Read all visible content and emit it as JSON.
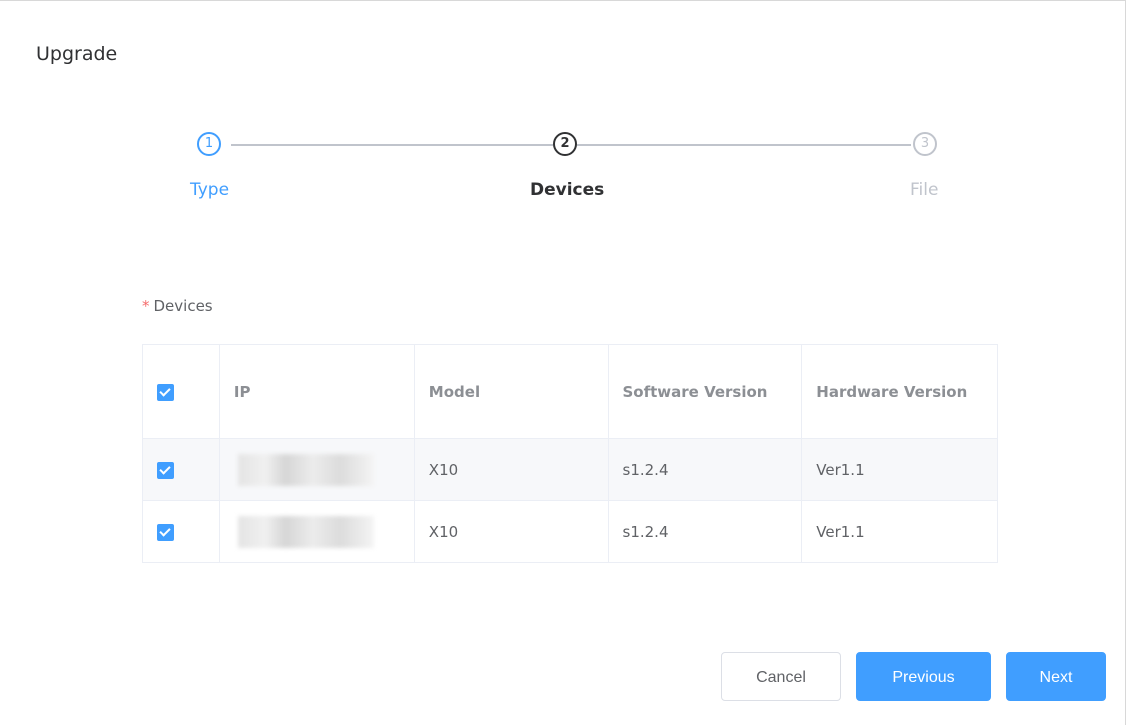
{
  "dialog": {
    "title": "Upgrade"
  },
  "steps": [
    {
      "number": "1",
      "label": "Type",
      "status": "finished"
    },
    {
      "number": "2",
      "label": "Devices",
      "status": "current"
    },
    {
      "number": "3",
      "label": "File",
      "status": "waiting"
    }
  ],
  "form": {
    "required_mark": "*",
    "devices_label": "Devices"
  },
  "table": {
    "header_checked": true,
    "columns": [
      "IP",
      "Model",
      "Software Version",
      "Hardware Version"
    ],
    "rows": [
      {
        "checked": true,
        "ip": "",
        "model": "X10",
        "software_version": "s1.2.4",
        "hardware_version": "Ver1.1"
      },
      {
        "checked": true,
        "ip": "",
        "model": "X10",
        "software_version": "s1.2.4",
        "hardware_version": "Ver1.1"
      }
    ]
  },
  "buttons": {
    "cancel": "Cancel",
    "previous": "Previous",
    "next": "Next"
  },
  "colors": {
    "primary": "#409eff",
    "required": "#f56c6c",
    "wait": "#c0c4cc"
  }
}
